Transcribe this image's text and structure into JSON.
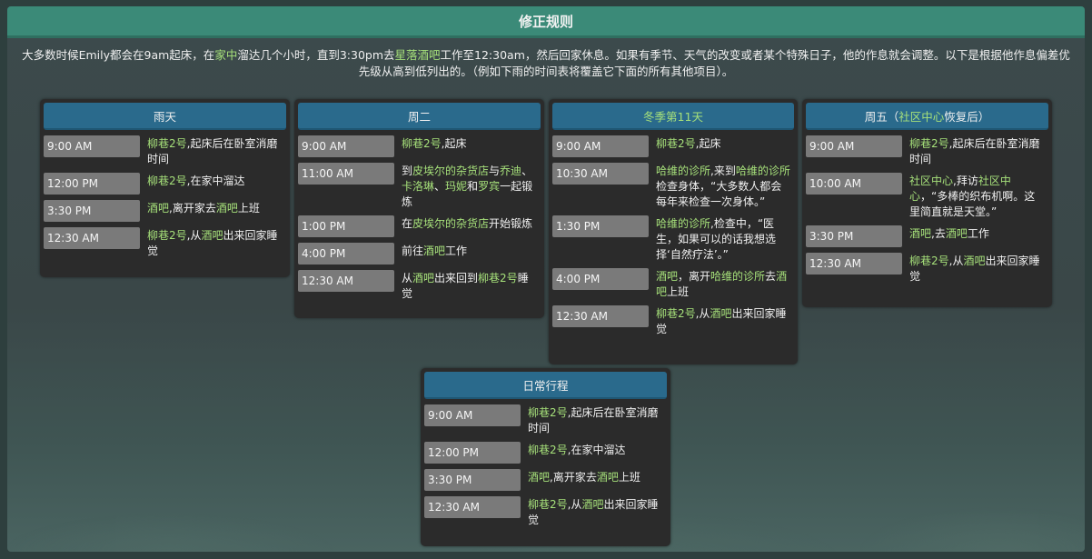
{
  "title": "修正规则",
  "intro": [
    {
      "t": "大多数时候Emily都会在9am起床，在"
    },
    {
      "t": "家中",
      "hl": true
    },
    {
      "t": "溜达几个小时，直到3:30pm去"
    },
    {
      "t": "星落酒吧",
      "hl": true
    },
    {
      "t": "工作至12:30am，然后回家休息。如果有季节、天气的改变或者某个特殊日子，他的作息就会调整。以下是根据他作息偏差优先级从高到低列出的。（例如下雨的时间表将覆盖它下面的所有其他项目）。"
    }
  ],
  "cards": [
    {
      "id": "rain",
      "header": [
        {
          "t": "雨天"
        }
      ],
      "rows": [
        {
          "time": "9:00 AM",
          "desc": [
            {
              "t": "柳巷2号",
              "hl": true
            },
            {
              "t": ",起床后在卧室消磨时间"
            }
          ]
        },
        {
          "time": "12:00 PM",
          "desc": [
            {
              "t": "柳巷2号",
              "hl": true
            },
            {
              "t": ",在家中溜达"
            }
          ]
        },
        {
          "time": "3:30 PM",
          "desc": [
            {
              "t": "酒吧",
              "hl": true
            },
            {
              "t": ",离开家去"
            },
            {
              "t": "酒吧",
              "hl": true
            },
            {
              "t": "上班"
            }
          ]
        },
        {
          "time": "12:30 AM",
          "desc": [
            {
              "t": "柳巷2号",
              "hl": true
            },
            {
              "t": ",从"
            },
            {
              "t": "酒吧",
              "hl": true
            },
            {
              "t": "出来回家睡觉"
            }
          ]
        }
      ]
    },
    {
      "id": "tuesday",
      "header": [
        {
          "t": "周二"
        }
      ],
      "rows": [
        {
          "time": "9:00 AM",
          "desc": [
            {
              "t": "柳巷2号",
              "hl": true
            },
            {
              "t": ",起床"
            }
          ]
        },
        {
          "time": "11:00 AM",
          "desc": [
            {
              "t": "到"
            },
            {
              "t": "皮埃尔的杂货店",
              "hl": true
            },
            {
              "t": "与"
            },
            {
              "t": "乔迪",
              "hl": true
            },
            {
              "t": "、"
            },
            {
              "t": "卡洛琳",
              "hl": true
            },
            {
              "t": "、"
            },
            {
              "t": "玛妮",
              "hl": true
            },
            {
              "t": "和"
            },
            {
              "t": "罗宾",
              "hl": true
            },
            {
              "t": "一起锻炼"
            }
          ]
        },
        {
          "time": "1:00 PM",
          "desc": [
            {
              "t": "在"
            },
            {
              "t": "皮埃尔的杂货店",
              "hl": true
            },
            {
              "t": "开始锻炼"
            }
          ]
        },
        {
          "time": "4:00 PM",
          "desc": [
            {
              "t": "前往"
            },
            {
              "t": "酒吧",
              "hl": true
            },
            {
              "t": "工作"
            }
          ]
        },
        {
          "time": "12:30 AM",
          "desc": [
            {
              "t": "从"
            },
            {
              "t": "酒吧",
              "hl": true
            },
            {
              "t": "出来回到"
            },
            {
              "t": "柳巷2号",
              "hl": true
            },
            {
              "t": "睡觉"
            }
          ]
        }
      ]
    },
    {
      "id": "winter11",
      "header": [
        {
          "t": "冬季第11天",
          "hl": true
        }
      ],
      "rows": [
        {
          "time": "9:00 AM",
          "desc": [
            {
              "t": "柳巷2号",
              "hl": true
            },
            {
              "t": ",起床"
            }
          ]
        },
        {
          "time": "10:30 AM",
          "desc": [
            {
              "t": "哈维的诊所",
              "hl": true
            },
            {
              "t": ",来到"
            },
            {
              "t": "哈维的诊所",
              "hl": true
            },
            {
              "t": "检查身体，“大多数人都会每年来检查一次身体。”"
            }
          ]
        },
        {
          "time": "1:30 PM",
          "desc": [
            {
              "t": "哈维的诊所",
              "hl": true
            },
            {
              "t": ",检查中，“医生，如果可以的话我想选择‘自然疗法’。”"
            }
          ]
        },
        {
          "time": "4:00 PM",
          "desc": [
            {
              "t": "酒吧",
              "hl": true
            },
            {
              "t": "，离开"
            },
            {
              "t": "哈维的诊所",
              "hl": true
            },
            {
              "t": "去"
            },
            {
              "t": "酒吧",
              "hl": true
            },
            {
              "t": "上班"
            }
          ]
        },
        {
          "time": "12:30 AM",
          "desc": [
            {
              "t": "柳巷2号",
              "hl": true
            },
            {
              "t": ",从"
            },
            {
              "t": "酒吧",
              "hl": true
            },
            {
              "t": "出来回家睡觉"
            }
          ]
        }
      ]
    },
    {
      "id": "friday",
      "header": [
        {
          "t": "周五（"
        },
        {
          "t": "社区中心",
          "hl": true
        },
        {
          "t": "恢复后）"
        }
      ],
      "rows": [
        {
          "time": "9:00 AM",
          "desc": [
            {
              "t": "柳巷2号",
              "hl": true
            },
            {
              "t": ",起床后在卧室消磨时间"
            }
          ]
        },
        {
          "time": "10:00 AM",
          "desc": [
            {
              "t": "社区中心",
              "hl": true
            },
            {
              "t": ",拜访"
            },
            {
              "t": "社区中心",
              "hl": true
            },
            {
              "t": "，“多棒的织布机啊。这里简直就是天堂。”"
            }
          ]
        },
        {
          "time": "3:30 PM",
          "desc": [
            {
              "t": "酒吧",
              "hl": true
            },
            {
              "t": ",去"
            },
            {
              "t": "酒吧",
              "hl": true
            },
            {
              "t": "工作"
            }
          ]
        },
        {
          "time": "12:30 AM",
          "desc": [
            {
              "t": "柳巷2号",
              "hl": true
            },
            {
              "t": ",从"
            },
            {
              "t": "酒吧",
              "hl": true
            },
            {
              "t": "出来回家睡觉"
            }
          ]
        }
      ]
    },
    {
      "id": "daily",
      "header": [
        {
          "t": "日常行程"
        }
      ],
      "rows": [
        {
          "time": "9:00 AM",
          "desc": [
            {
              "t": "柳巷2号",
              "hl": true
            },
            {
              "t": ",起床后在卧室消磨时间"
            }
          ]
        },
        {
          "time": "12:00 PM",
          "desc": [
            {
              "t": "柳巷2号",
              "hl": true
            },
            {
              "t": ",在家中溜达"
            }
          ]
        },
        {
          "time": "3:30 PM",
          "desc": [
            {
              "t": "酒吧",
              "hl": true
            },
            {
              "t": ",离开家去"
            },
            {
              "t": "酒吧",
              "hl": true
            },
            {
              "t": "上班"
            }
          ]
        },
        {
          "time": "12:30 AM",
          "desc": [
            {
              "t": "柳巷2号",
              "hl": true
            },
            {
              "t": ",从"
            },
            {
              "t": "酒吧",
              "hl": true
            },
            {
              "t": "出来回家睡觉"
            }
          ]
        }
      ]
    }
  ],
  "colors": {
    "highlight": "#a6e07a",
    "header_bar": "#2a6a8c",
    "title_bar": "#3b8a78"
  }
}
